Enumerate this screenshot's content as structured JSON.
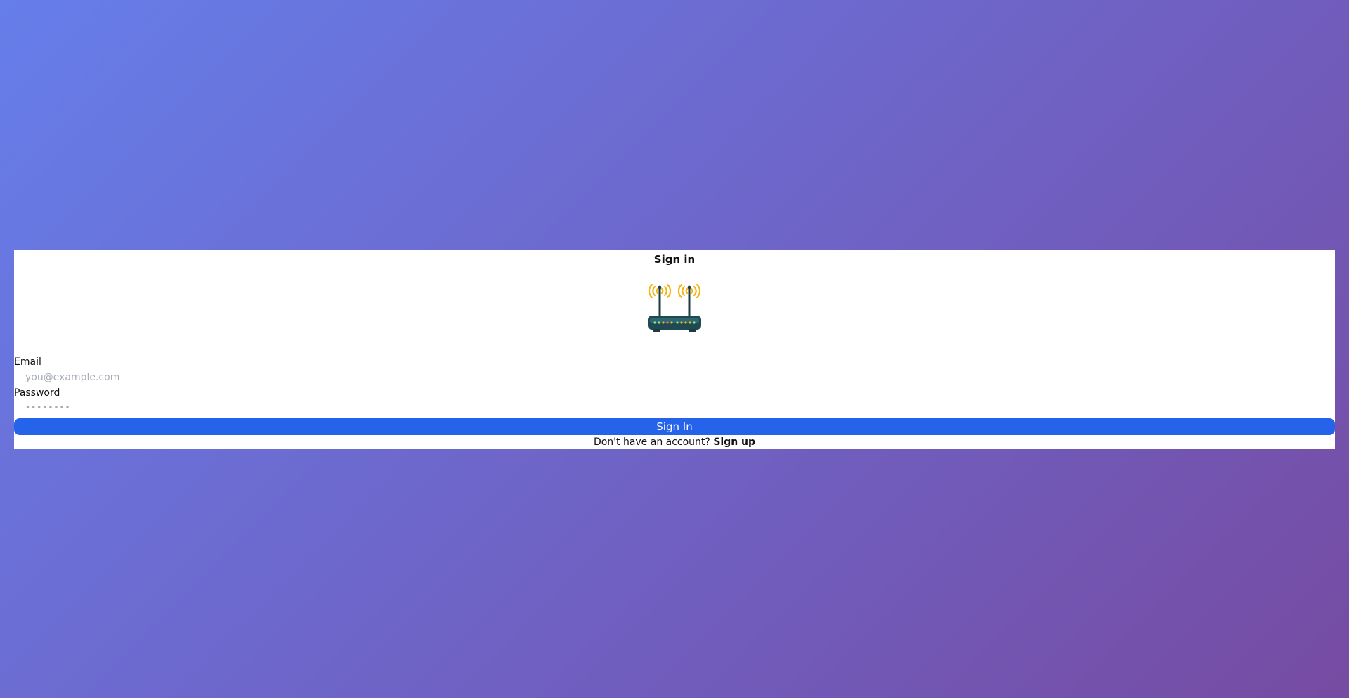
{
  "card": {
    "title": "Sign in"
  },
  "logo": {
    "icon": "router-icon",
    "colors": {
      "body": "#1f4a52",
      "waves": "#f3b51b",
      "leds": [
        "#f3b51b",
        "#ff6b6b",
        "#8ee39c"
      ]
    }
  },
  "form": {
    "email": {
      "label": "Email",
      "placeholder": "you@example.com",
      "value": ""
    },
    "password": {
      "label": "Password",
      "placeholder": "••••••••",
      "value": ""
    },
    "submit_label": "Sign In"
  },
  "footer": {
    "prompt": "Don't have an account?",
    "link_label": "Sign up"
  },
  "colors": {
    "background_start": "#667eea",
    "background_end": "#764ba2",
    "primary": "#2563eb"
  }
}
